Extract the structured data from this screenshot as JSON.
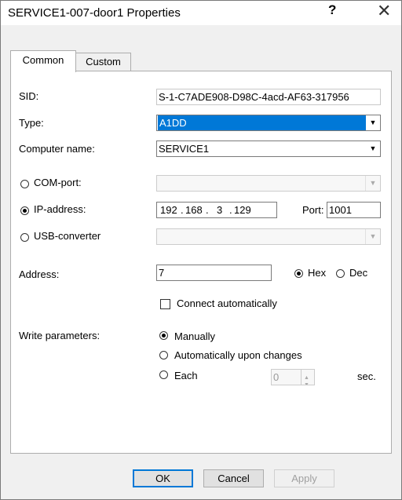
{
  "window": {
    "title": "SERVICE1-007-door1 Properties",
    "help_glyph": "?",
    "close_glyph": "✕"
  },
  "tabs": [
    {
      "label": "Common"
    },
    {
      "label": "Custom"
    }
  ],
  "form": {
    "sid_label": "SID:",
    "sid_value": "S-1-C7ADE908-D98C-4acd-AF63-317956",
    "type_label": "Type:",
    "type_value": "A1DD",
    "computer_label": "Computer name:",
    "computer_value": "SERVICE1",
    "com_label": "COM-port:",
    "ip_label": "IP-address:",
    "ip": [
      "192",
      "168",
      "3",
      "129"
    ],
    "port_label": "Port:",
    "port_value": "1001",
    "usb_label": "USB-converter",
    "address_label": "Address:",
    "address_value": "7",
    "hex_label": "Hex",
    "dec_label": "Dec",
    "connect_label": "Connect automatically",
    "write_label": "Write parameters:",
    "manually_label": "Manually",
    "auto_label": "Automatically upon changes",
    "each_label": "Each",
    "each_value": "0",
    "sec_label": "sec."
  },
  "buttons": {
    "ok": "OK",
    "cancel": "Cancel",
    "apply": "Apply"
  }
}
